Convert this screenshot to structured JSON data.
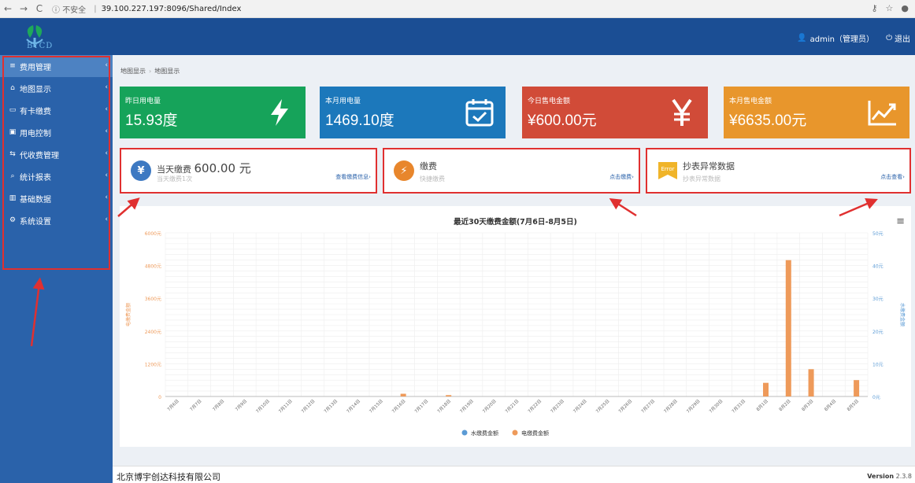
{
  "browser": {
    "back": "←",
    "forward": "→",
    "reload": "C",
    "security": "不安全",
    "url": "39.100.227.197:8096/Shared/Index"
  },
  "header": {
    "logo_text": "BYCD",
    "user": "admin（管理员）",
    "logout": "退出"
  },
  "sidebar": {
    "items": [
      {
        "icon": "≡",
        "label": "费用管理"
      },
      {
        "icon": "⌂",
        "label": "地图显示"
      },
      {
        "icon": "▭",
        "label": "有卡缴费"
      },
      {
        "icon": "▣",
        "label": "用电控制"
      },
      {
        "icon": "⇆",
        "label": "代收费管理"
      },
      {
        "icon": "⌕",
        "label": "统计报表"
      },
      {
        "icon": "▥",
        "label": "基础数据"
      },
      {
        "icon": "⚙",
        "label": "系统设置"
      }
    ]
  },
  "breadcrumb": [
    "地图显示",
    "地图显示"
  ],
  "stats": [
    {
      "label": "昨日用电量",
      "value": "15.93度"
    },
    {
      "label": "本月用电量",
      "value": "1469.10度"
    },
    {
      "label": "今日售电金额",
      "value": "¥600.00元"
    },
    {
      "label": "本月售电金额",
      "value": "¥6635.00元"
    }
  ],
  "info": [
    {
      "title": "当天缴费",
      "amount": "600.00 元",
      "sub": "当天缴费1次",
      "link": "查看缴费信息›"
    },
    {
      "title": "缴费",
      "amount": "",
      "sub": "快捷缴费",
      "link": "点击缴费›"
    },
    {
      "title": "抄表异常数据",
      "amount": "",
      "sub": "抄表异常数据",
      "link": "点击查看›"
    }
  ],
  "chart_data": {
    "type": "bar",
    "title": "最近30天缴费金额(7月6日-8月5日)",
    "ylabel": "电缴费金额",
    "y2label": "水缴费金额",
    "ylim": [
      0,
      6000
    ],
    "y2lim": [
      0,
      50
    ],
    "yticks": [
      "0",
      "1200元",
      "2400元",
      "3600元",
      "4800元",
      "6000元"
    ],
    "y2ticks": [
      "0元",
      "10元",
      "20元",
      "30元",
      "40元",
      "50元"
    ],
    "categories": [
      "7月6日",
      "7月7日",
      "7月8日",
      "7月9日",
      "7月10日",
      "7月11日",
      "7月12日",
      "7月13日",
      "7月14日",
      "7月15日",
      "7月16日",
      "7月17日",
      "7月18日",
      "7月19日",
      "7月20日",
      "7月21日",
      "7月22日",
      "7月23日",
      "7月24日",
      "7月25日",
      "7月26日",
      "7月27日",
      "7月28日",
      "7月29日",
      "7月30日",
      "7月31日",
      "8月1日",
      "8月2日",
      "8月3日",
      "8月4日",
      "8月5日"
    ],
    "series": [
      {
        "name": "水缴费金额",
        "color": "#5b9bd5",
        "values": [
          0,
          0,
          0,
          0,
          0,
          0,
          0,
          0,
          0,
          0,
          0,
          0,
          0,
          0,
          0,
          0,
          0,
          0,
          0,
          0,
          0,
          0,
          0,
          0,
          0,
          0,
          0,
          0,
          0,
          0,
          0
        ]
      },
      {
        "name": "电缴费金额",
        "color": "#ee9a5a",
        "values": [
          0,
          0,
          0,
          0,
          0,
          0,
          0,
          0,
          0,
          0,
          100,
          0,
          50,
          0,
          0,
          0,
          0,
          0,
          0,
          0,
          0,
          0,
          0,
          0,
          0,
          0,
          500,
          5000,
          1000,
          0,
          600
        ]
      }
    ],
    "legend_position": "bottom",
    "grid": true
  },
  "footer": {
    "company": "北京博宇创达科技有限公司",
    "version_label": "Version",
    "version": "2.3.8"
  },
  "colors": {
    "topbar": "#1b4e94",
    "sidebar": "#2a62aa",
    "green": "#16a35a",
    "blue": "#1c78bb",
    "red": "#d14b38",
    "orange": "#e8962c",
    "highlight": "#e03030"
  }
}
